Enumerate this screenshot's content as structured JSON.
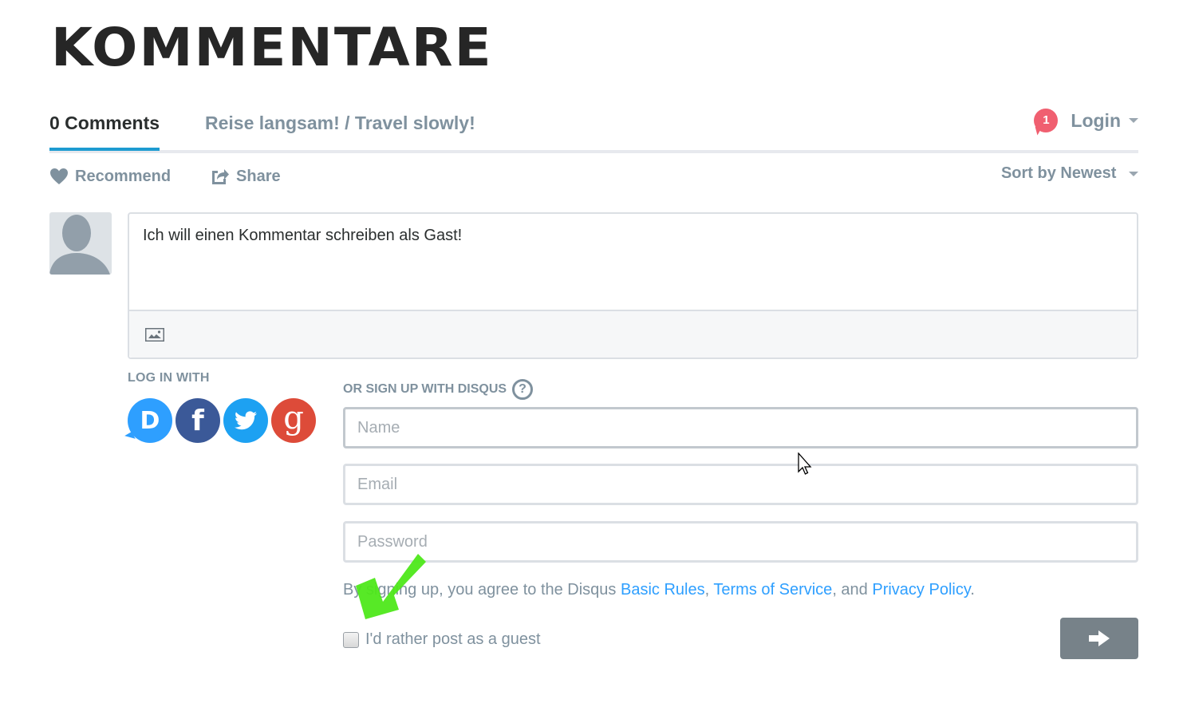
{
  "page": {
    "title": "KOMMENTARE"
  },
  "tabs": {
    "comments": "0 Comments",
    "forum": "Reise langsam! / Travel slowly!",
    "notification_count": "1",
    "login": "Login"
  },
  "actions": {
    "recommend": "Recommend",
    "share": "Share",
    "sort": "Sort by Newest"
  },
  "editor": {
    "text": "Ich will einen Kommentar schreiben als Gast!"
  },
  "login_with": {
    "label": "LOG IN WITH",
    "providers": [
      {
        "name": "Disqus",
        "glyph": "D",
        "color": "#2e9fff"
      },
      {
        "name": "Facebook",
        "glyph": "f",
        "color": "#3b5998"
      },
      {
        "name": "Twitter",
        "glyph": "twitter-bird",
        "color": "#1da1f2"
      },
      {
        "name": "Google",
        "glyph": "g",
        "color": "#dd4b39"
      }
    ]
  },
  "signup": {
    "label": "OR SIGN UP WITH DISQUS",
    "help": "?",
    "name_placeholder": "Name",
    "email_placeholder": "Email",
    "password_placeholder": "Password",
    "terms_prefix": "By signing up, you agree to the Disqus ",
    "basic_rules": "Basic Rules",
    "sep1": ", ",
    "terms_of_service": "Terms of Service",
    "sep2": ", and ",
    "privacy_policy": "Privacy Policy",
    "terms_suffix": ".",
    "guest_label": "I'd rather post as a guest",
    "guest_checked": false
  },
  "colors": {
    "accent": "#1d9bd1",
    "link": "#2e9fff",
    "notification": "#f05f70",
    "muted_text": "#7f919e",
    "submit_bg": "#778289",
    "annotation_arrow": "#4ee81a"
  }
}
